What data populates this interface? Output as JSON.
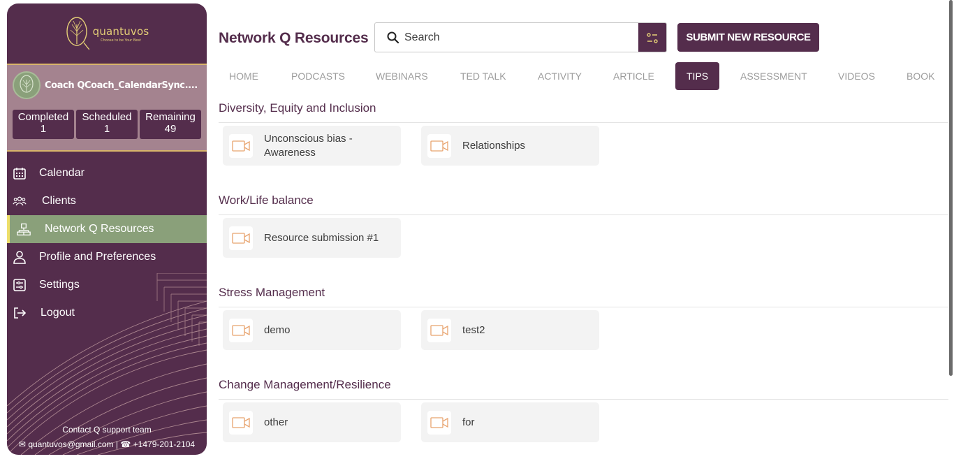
{
  "brand": {
    "name": "quantuvos",
    "tagline": "Choose to be Your Best"
  },
  "coach": {
    "name": "Coach QCoach_CalendarSync...."
  },
  "stats": [
    {
      "label": "Completed",
      "value": "1"
    },
    {
      "label": "Scheduled",
      "value": "1"
    },
    {
      "label": "Remaining",
      "value": "49"
    }
  ],
  "nav": [
    {
      "label": "Calendar",
      "icon": "calendar-icon"
    },
    {
      "label": "Clients",
      "icon": "users-icon"
    },
    {
      "label": "Network Q Resources",
      "icon": "network-icon",
      "active": true
    },
    {
      "label": "Profile and Preferences",
      "icon": "profile-icon"
    },
    {
      "label": "Settings",
      "icon": "settings-icon"
    },
    {
      "label": "Logout",
      "icon": "logout-icon"
    }
  ],
  "contact": {
    "title": "Contact Q support team",
    "email": "quantuvos@gmail.com",
    "phone": "+1479-201-2104"
  },
  "header": {
    "title": "Network Q Resources",
    "search_placeholder": "Search",
    "submit_label": "SUBMIT NEW RESOURCE"
  },
  "tabs": [
    "HOME",
    "PODCASTS",
    "WEBINARS",
    "TED TALK",
    "ACTIVITY",
    "ARTICLE",
    "TIPS",
    "ASSESSMENT",
    "VIDEOS",
    "BOOK"
  ],
  "active_tab": "TIPS",
  "sections": [
    {
      "title": "Diversity, Equity and Inclusion",
      "items": [
        "Unconscious bias - Awareness",
        "Relationships"
      ]
    },
    {
      "title": "Work/Life balance",
      "items": [
        "Resource submission #1"
      ]
    },
    {
      "title": "Stress Management",
      "items": [
        "demo",
        "test2"
      ]
    },
    {
      "title": "Change Management/Resilience",
      "items": [
        "other",
        "for"
      ]
    }
  ],
  "colors": {
    "primary": "#542d4c",
    "accent": "#8aa07a",
    "gold": "#e5cf77",
    "video_icon": "#e8a36e"
  }
}
